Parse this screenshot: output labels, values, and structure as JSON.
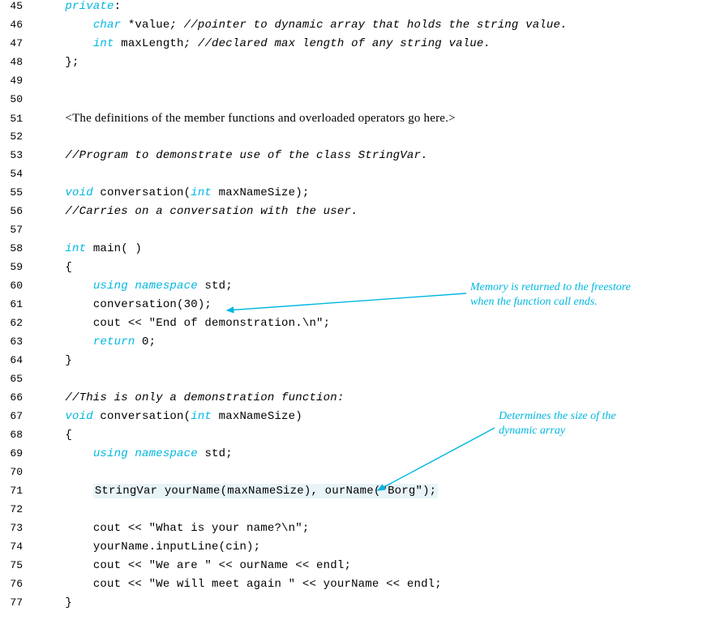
{
  "lines": {
    "45": {
      "num": "45",
      "indent1": "    ",
      "kw": "private",
      "rest": ":"
    },
    "46": {
      "num": "46",
      "indent1": "        ",
      "kw": "char",
      "rest1": " *value",
      "cmt": "; //pointer to dynamic array that holds the string value."
    },
    "47": {
      "num": "47",
      "indent1": "        ",
      "kw": "int",
      "rest1": " maxLength",
      "cmt": "; //declared max length of any string value."
    },
    "48": {
      "num": "48",
      "indent1": "    ",
      "rest": "};"
    },
    "49": {
      "num": "49"
    },
    "50": {
      "num": "50"
    },
    "51": {
      "num": "51",
      "indent1": "    ",
      "body": "<The definitions of the member functions and overloaded operators go here.>"
    },
    "52": {
      "num": "52"
    },
    "53": {
      "num": "53",
      "indent1": "    ",
      "cmt": "//Program to demonstrate use of the class StringVar."
    },
    "54": {
      "num": "54"
    },
    "55": {
      "num": "55",
      "indent1": "    ",
      "kw1": "void",
      "mid1": " conversation(",
      "kw2": "int",
      "rest": " maxNameSize);"
    },
    "56": {
      "num": "56",
      "indent1": "    ",
      "cmt": "//Carries on a conversation with the user."
    },
    "57": {
      "num": "57"
    },
    "58": {
      "num": "58",
      "indent1": "    ",
      "kw": "int",
      "rest": " main( )"
    },
    "59": {
      "num": "59",
      "indent1": "    ",
      "rest": "{"
    },
    "60": {
      "num": "60",
      "indent1": "        ",
      "kw": "using namespace",
      "rest": " std;"
    },
    "61": {
      "num": "61",
      "indent1": "        ",
      "rest": "conversation(30);"
    },
    "62": {
      "num": "62",
      "indent1": "        ",
      "rest": "cout << \"End of demonstration.\\n\";"
    },
    "63": {
      "num": "63",
      "indent1": "        ",
      "kw": "return",
      "rest": " 0;"
    },
    "64": {
      "num": "64",
      "indent1": "    ",
      "rest": "}"
    },
    "65": {
      "num": "65"
    },
    "66": {
      "num": "66",
      "indent1": "    ",
      "cmt": "//This is only a demonstration function:"
    },
    "67": {
      "num": "67",
      "indent1": "    ",
      "kw1": "void",
      "mid1": " conversation(",
      "kw2": "int",
      "rest": " maxNameSize)"
    },
    "68": {
      "num": "68",
      "indent1": "    ",
      "rest": "{"
    },
    "69": {
      "num": "69",
      "indent1": "        ",
      "kw": "using namespace",
      "rest": " std;"
    },
    "70": {
      "num": "70"
    },
    "71": {
      "num": "71",
      "indent1": "        ",
      "hl": "StringVar yourName(maxNameSize), ourName(\"Borg\");"
    },
    "72": {
      "num": "72"
    },
    "73": {
      "num": "73",
      "indent1": "        ",
      "rest": "cout << \"What is your name?\\n\";"
    },
    "74": {
      "num": "74",
      "indent1": "        ",
      "rest": "yourName.inputLine(cin);"
    },
    "75": {
      "num": "75",
      "indent1": "        ",
      "rest": "cout << \"We are \" << ourName << endl;"
    },
    "76": {
      "num": "76",
      "indent1": "        ",
      "rest": "cout << \"We will meet again \" << yourName << endl;"
    },
    "77": {
      "num": "77",
      "indent1": "    ",
      "rest": "}"
    }
  },
  "annotations": {
    "a1": {
      "line1": "Memory is returned to the freestore",
      "line2": "when the function call ends."
    },
    "a2": {
      "line1": "Determines the size of the",
      "line2": "dynamic array"
    }
  }
}
